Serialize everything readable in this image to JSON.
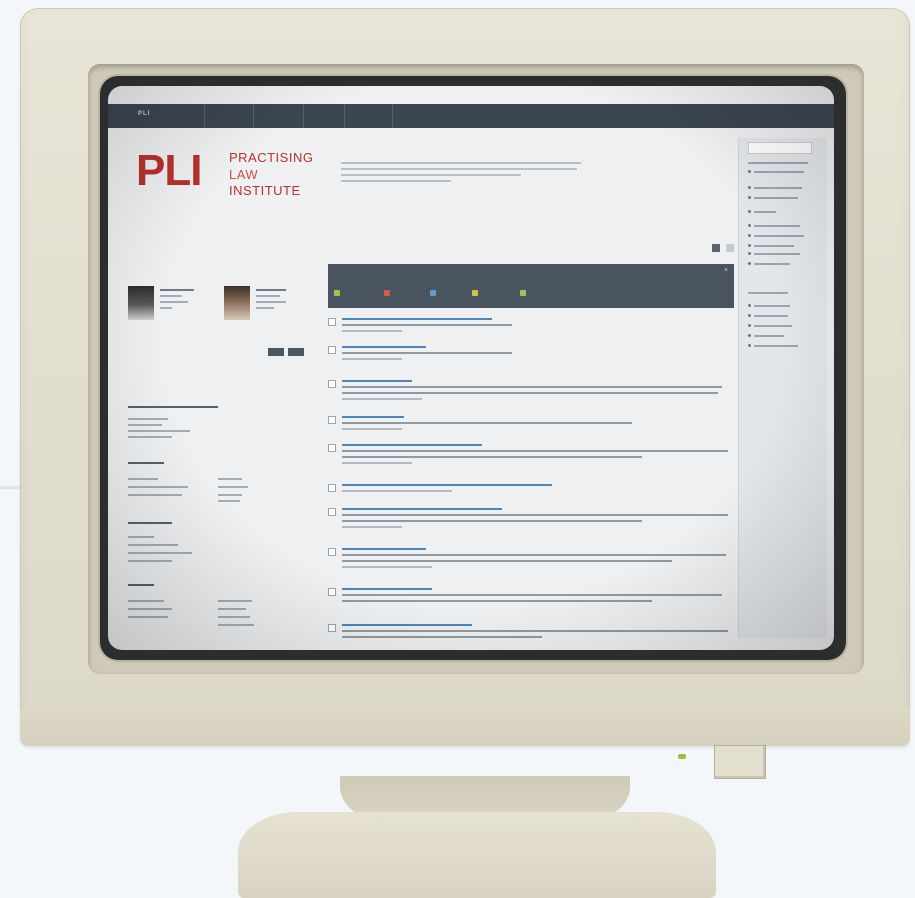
{
  "screen": {
    "navbar": {
      "logo": "PLI",
      "items": [
        "",
        "",
        "",
        ""
      ],
      "user": ""
    },
    "pli_logo": {
      "mark": "PLI",
      "line1": "PRACTISING",
      "line2": "LAW",
      "line3": "INSTITUTE"
    },
    "headline": "",
    "left": {
      "colleagues_title": "",
      "resources_title": "",
      "profile_1": "",
      "profile_2": ""
    },
    "feed": {
      "title": "",
      "close_label": "×",
      "tabs": [
        "",
        "",
        "",
        "",
        ""
      ],
      "items": [
        "",
        "",
        "",
        "",
        "",
        "",
        "",
        "",
        "",
        "",
        "",
        ""
      ]
    }
  },
  "colors": {
    "brand_red": "#b8312b",
    "navbar": "#3c4650",
    "feed_header": "#4a545e",
    "bezel": "#e2dece"
  }
}
